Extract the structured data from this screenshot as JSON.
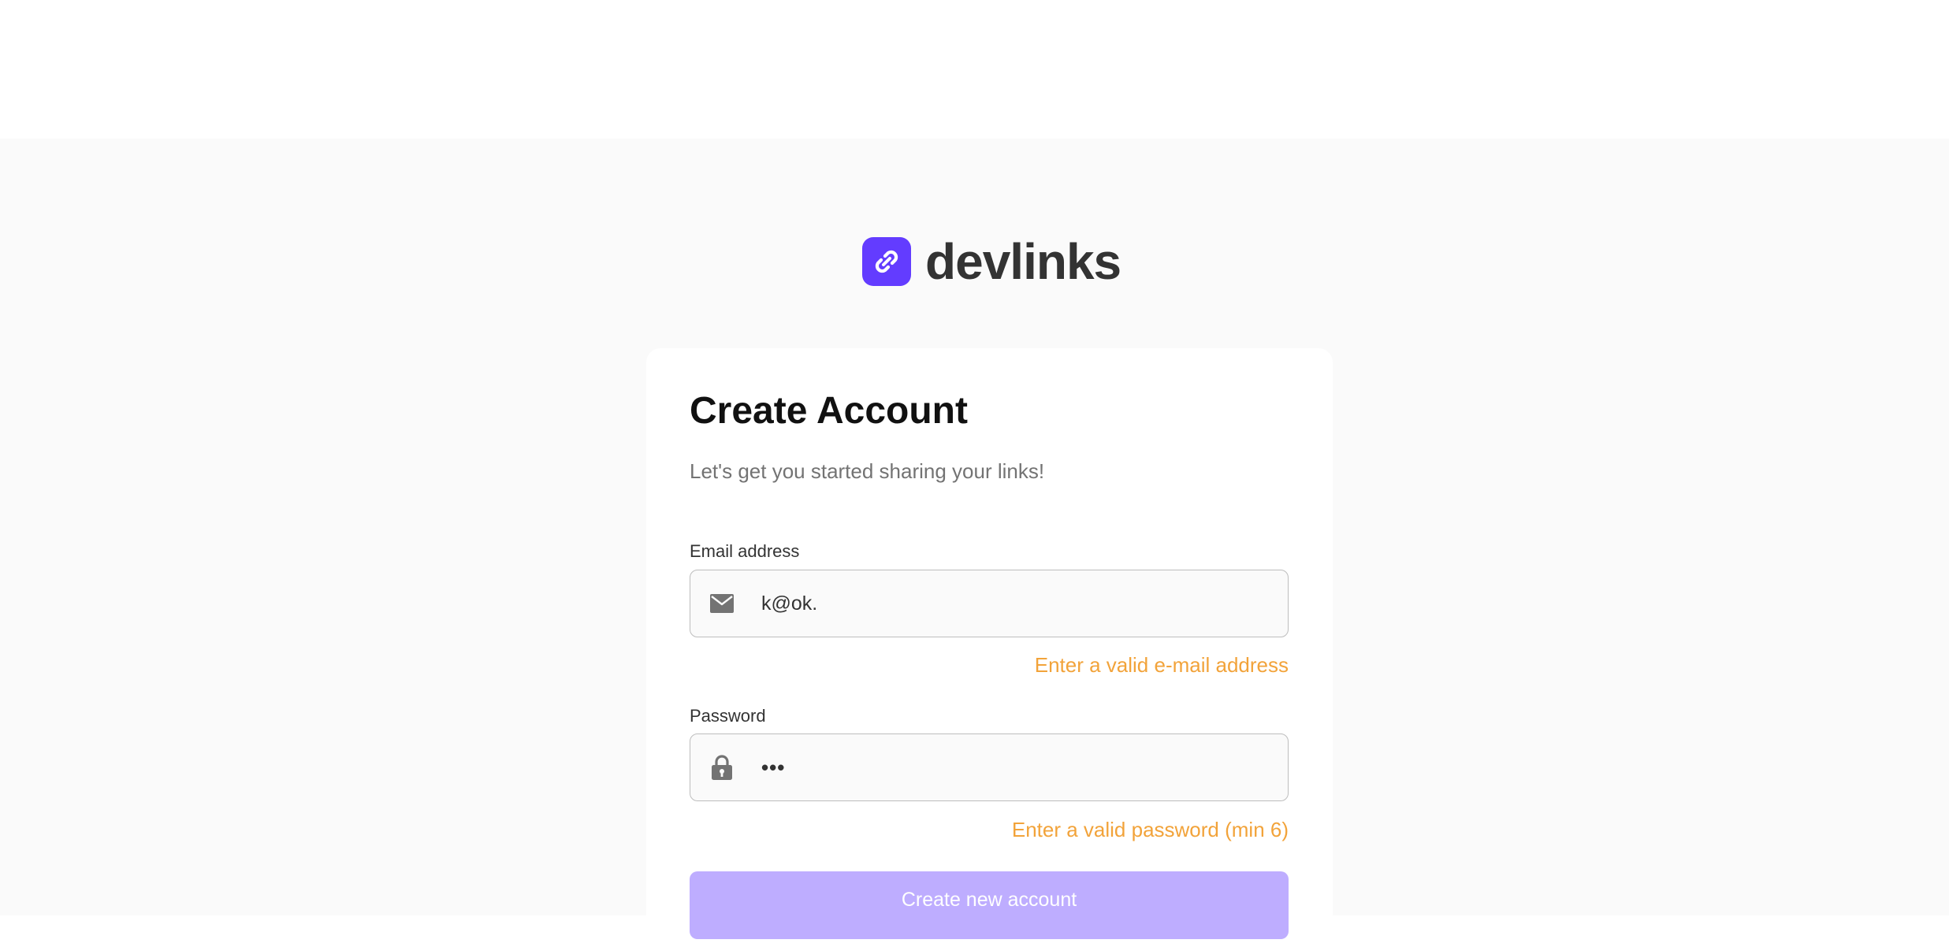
{
  "brand": {
    "name": "devlinks",
    "logo_icon": "link-icon",
    "accent_color": "#633cff"
  },
  "form": {
    "title": "Create Account",
    "subtitle": "Let's get you started sharing your links!",
    "email": {
      "label": "Email address",
      "value": "k@ok.",
      "icon": "envelope-icon",
      "error": "Enter a valid e-mail address"
    },
    "password": {
      "label": "Password",
      "value": "•••",
      "icon": "lock-icon",
      "error": "Enter a valid password (min 6)"
    },
    "submit_label": "Create new account",
    "error_color": "#f2a33a",
    "button_color": "#beadff"
  }
}
